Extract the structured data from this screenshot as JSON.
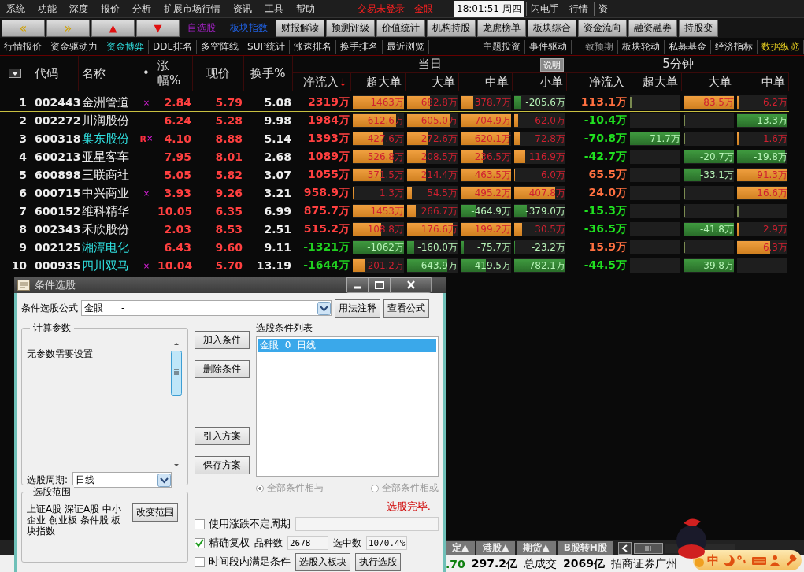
{
  "menu": {
    "items": [
      "系统",
      "功能",
      "深度",
      "报价",
      "分析",
      "扩展市场行情",
      "资讯",
      "工具",
      "帮助"
    ],
    "status": [
      "交易未登录",
      "金眼"
    ],
    "clock": "18:01:51 周四",
    "quick": [
      "闪电手",
      "行情",
      "资"
    ]
  },
  "toolbar": {
    "nav": [
      {
        "label": "«",
        "kind": "arrow"
      },
      {
        "label": "»",
        "kind": "arrow"
      },
      {
        "label": "▲",
        "kind": "triangle"
      },
      {
        "label": "▼",
        "kind": "triangle"
      }
    ],
    "links": [
      {
        "label": "自选股",
        "color": "#a020c0"
      },
      {
        "label": "板块指数",
        "color": "#2060e0"
      }
    ],
    "buttons": [
      "财报解读",
      "预测评级",
      "价值统计",
      "机构持股",
      "龙虎榜单",
      "板块综合",
      "资金流向",
      "融资融券",
      "持股变"
    ]
  },
  "tabs_left": [
    {
      "label": "行情报价",
      "selected": false
    },
    {
      "label": "资金驱动力",
      "selected": false
    },
    {
      "label": "资金博弈",
      "selected": true
    },
    {
      "label": "DDE排名",
      "selected": false
    },
    {
      "label": "多空阵线",
      "selected": false
    },
    {
      "label": "SUP统计",
      "selected": false
    },
    {
      "label": "涨速排名",
      "selected": false
    },
    {
      "label": "换手排名",
      "selected": false
    },
    {
      "label": "最近浏览",
      "selected": false
    }
  ],
  "tabs_right": [
    {
      "label": "主题投资",
      "kind": "normal"
    },
    {
      "label": "事件驱动",
      "kind": "normal"
    },
    {
      "label": "一致预期",
      "kind": "dim"
    },
    {
      "label": "板块轮动",
      "kind": "normal"
    },
    {
      "label": "私募基金",
      "kind": "normal"
    },
    {
      "label": "经济指标",
      "kind": "normal"
    },
    {
      "label": "数据纵览",
      "kind": "accent"
    }
  ],
  "table": {
    "columns": [
      "代码",
      "名称",
      "•",
      "涨幅%",
      "现价",
      "换手%"
    ],
    "group_today": {
      "title": "当日",
      "button": "说明",
      "columns": [
        "净流入",
        "超大单",
        "大单",
        "中单",
        "小单"
      ],
      "sort_arrow": "↓"
    },
    "group_5min": {
      "title": "5分钟",
      "columns": [
        "净流入",
        "超大单",
        "大单",
        "中单"
      ]
    },
    "rows": [
      {
        "rank": "1",
        "code": "002443",
        "name": "金洲管道",
        "highlight": false,
        "tag": "",
        "mark": "×",
        "change": "2.84",
        "price": "5.79",
        "turnover": "5.08",
        "selected": true,
        "net": {
          "value": "2319万",
          "kind": "up"
        },
        "bars": [
          {
            "value": "1463万",
            "kind": "up",
            "level": 1
          },
          {
            "value": "682.8万",
            "kind": "up",
            "level": 0.45
          },
          {
            "value": "378.7万",
            "kind": "up",
            "level": 0.25
          },
          {
            "value": "-205.6万",
            "kind": "down",
            "level": 0.12
          }
        ],
        "net5": {
          "value": "113.1万",
          "kind": "up"
        },
        "bars5": [
          {
            "kind": "flat"
          },
          {
            "value": "83.5万",
            "kind": "up",
            "level": 1
          },
          {
            "value": "6.2万",
            "kind": "up",
            "level": 0.05
          }
        ]
      },
      {
        "rank": "2",
        "code": "002272",
        "name": "川润股份",
        "highlight": false,
        "tag": "",
        "mark": "",
        "change": "6.24",
        "price": "5.28",
        "turnover": "9.98",
        "selected": false,
        "net": {
          "value": "1984万",
          "kind": "up"
        },
        "bars": [
          {
            "value": "612.6万",
            "kind": "up",
            "level": 0.85
          },
          {
            "value": "605.0万",
            "kind": "up",
            "level": 0.85
          },
          {
            "value": "704.9万",
            "kind": "up",
            "level": 1
          },
          {
            "value": "62.0万",
            "kind": "up",
            "level": 0.08
          }
        ],
        "net5": {
          "value": "-10.4万",
          "kind": "down"
        },
        "bars5": [
          {
            "kind": "empty"
          },
          {
            "kind": "flat"
          },
          {
            "value": "-13.3万",
            "kind": "down",
            "level": 1
          }
        ]
      },
      {
        "rank": "3",
        "code": "600318",
        "name": "巢东股份",
        "highlight": true,
        "tag": "R",
        "mark": "×",
        "change": "4.10",
        "price": "8.88",
        "turnover": "5.14",
        "selected": false,
        "net": {
          "value": "1393万",
          "kind": "up"
        },
        "bars": [
          {
            "value": "427.6万",
            "kind": "up",
            "level": 0.6
          },
          {
            "value": "272.6万",
            "kind": "up",
            "level": 0.4
          },
          {
            "value": "620.1万",
            "kind": "up",
            "level": 0.95
          },
          {
            "value": "72.8万",
            "kind": "up",
            "level": 0.1
          }
        ],
        "net5": {
          "value": "-70.8万",
          "kind": "down"
        },
        "bars5": [
          {
            "value": "-71.7万",
            "kind": "down",
            "level": 1
          },
          {
            "kind": "flat"
          },
          {
            "value": "1.6万",
            "kind": "up",
            "level": 0.03
          }
        ]
      },
      {
        "rank": "4",
        "code": "600213",
        "name": "亚星客车",
        "highlight": false,
        "tag": "",
        "mark": "",
        "change": "7.95",
        "price": "8.01",
        "turnover": "2.68",
        "selected": false,
        "net": {
          "value": "1089万",
          "kind": "up"
        },
        "bars": [
          {
            "value": "526.8万",
            "kind": "up",
            "level": 0.78
          },
          {
            "value": "208.5万",
            "kind": "up",
            "level": 0.38
          },
          {
            "value": "236.5万",
            "kind": "up",
            "level": 0.43
          },
          {
            "value": "116.9万",
            "kind": "up",
            "level": 0.22
          }
        ],
        "net5": {
          "value": "-42.7万",
          "kind": "down"
        },
        "bars5": [
          {
            "kind": "empty"
          },
          {
            "value": "-20.7万",
            "kind": "down",
            "level": 1
          },
          {
            "value": "-19.8万",
            "kind": "down",
            "level": 0.95
          }
        ]
      },
      {
        "rank": "5",
        "code": "600898",
        "name": "三联商社",
        "highlight": false,
        "tag": "",
        "mark": "",
        "change": "5.05",
        "price": "5.82",
        "turnover": "3.07",
        "selected": false,
        "net": {
          "value": "1055万",
          "kind": "up"
        },
        "bars": [
          {
            "value": "371.5万",
            "kind": "up",
            "level": 0.55
          },
          {
            "value": "214.4万",
            "kind": "up",
            "level": 0.38
          },
          {
            "value": "463.5万",
            "kind": "up",
            "level": 1
          },
          {
            "value": "6.0万",
            "kind": "up",
            "level": 0.02
          }
        ],
        "net5": {
          "value": "65.5万",
          "kind": "up"
        },
        "bars5": [
          {
            "kind": "empty"
          },
          {
            "value": "-33.1万",
            "kind": "down",
            "level": 0.35
          },
          {
            "value": "91.3万",
            "kind": "up",
            "level": 1
          }
        ]
      },
      {
        "rank": "6",
        "code": "000715",
        "name": "中兴商业",
        "highlight": false,
        "tag": "",
        "mark": "×",
        "change": "3.93",
        "price": "9.26",
        "turnover": "3.21",
        "selected": false,
        "net": {
          "value": "958.9万",
          "kind": "up"
        },
        "bars": [
          {
            "value": "1.3万",
            "kind": "up",
            "level": 0.02
          },
          {
            "value": "54.5万",
            "kind": "up",
            "level": 0.1
          },
          {
            "value": "495.2万",
            "kind": "up",
            "level": 1
          },
          {
            "value": "407.8万",
            "kind": "up",
            "level": 0.8
          }
        ],
        "net5": {
          "value": "24.0万",
          "kind": "up"
        },
        "bars5": [
          {
            "kind": "empty"
          },
          {
            "kind": "flat"
          },
          {
            "value": "16.6万",
            "kind": "up",
            "level": 1
          }
        ]
      },
      {
        "rank": "7",
        "code": "600152",
        "name": "维科精华",
        "highlight": false,
        "tag": "",
        "mark": "",
        "change": "10.05",
        "price": "6.35",
        "turnover": "6.99",
        "selected": false,
        "net": {
          "value": "875.7万",
          "kind": "up"
        },
        "bars": [
          {
            "value": "1453万",
            "kind": "up",
            "level": 1
          },
          {
            "value": "266.7万",
            "kind": "up",
            "level": 0.17
          },
          {
            "value": "-464.9万",
            "kind": "down",
            "level": 0.3
          },
          {
            "value": "-379.0万",
            "kind": "down",
            "level": 0.25
          }
        ],
        "net5": {
          "value": "-15.3万",
          "kind": "down"
        },
        "bars5": [
          {
            "kind": "empty"
          },
          {
            "kind": "flat"
          },
          {
            "kind": "flat"
          }
        ]
      },
      {
        "rank": "8",
        "code": "002343",
        "name": "禾欣股份",
        "highlight": false,
        "tag": "",
        "mark": "",
        "change": "2.03",
        "price": "8.53",
        "turnover": "2.51",
        "selected": false,
        "net": {
          "value": "515.2万",
          "kind": "up"
        },
        "bars": [
          {
            "value": "108.8万",
            "kind": "up",
            "level": 0.55
          },
          {
            "value": "176.6万",
            "kind": "up",
            "level": 0.9
          },
          {
            "value": "199.2万",
            "kind": "up",
            "level": 1
          },
          {
            "value": "30.5万",
            "kind": "up",
            "level": 0.15
          }
        ],
        "net5": {
          "value": "-36.5万",
          "kind": "down"
        },
        "bars5": [
          {
            "kind": "empty"
          },
          {
            "value": "-41.8万",
            "kind": "down",
            "level": 1
          },
          {
            "value": "2.9万",
            "kind": "up",
            "level": 0.05
          }
        ]
      },
      {
        "rank": "9",
        "code": "002125",
        "name": "湘潭电化",
        "highlight": true,
        "tag": "",
        "mark": "",
        "change": "6.43",
        "price": "9.60",
        "turnover": "9.11",
        "selected": false,
        "net": {
          "value": "-1321万",
          "kind": "down"
        },
        "bars": [
          {
            "value": "-1062万",
            "kind": "down",
            "level": 1
          },
          {
            "value": "-160.0万",
            "kind": "down",
            "level": 0.14
          },
          {
            "value": "-75.7万",
            "kind": "down",
            "level": 0.07
          },
          {
            "value": "-23.2万",
            "kind": "down",
            "level": 0.02
          }
        ],
        "net5": {
          "value": "15.9万",
          "kind": "up"
        },
        "bars5": [
          {
            "kind": "empty"
          },
          {
            "kind": "flat"
          },
          {
            "value": "6.3万",
            "kind": "up",
            "level": 0.65
          }
        ]
      },
      {
        "rank": "10",
        "code": "000935",
        "name": "四川双马",
        "highlight": true,
        "tag": "",
        "mark": "×",
        "change": "10.04",
        "price": "5.70",
        "turnover": "13.19",
        "selected": false,
        "net": {
          "value": "-1644万",
          "kind": "down"
        },
        "bars": [
          {
            "value": "201.2万",
            "kind": "up",
            "level": 0.25
          },
          {
            "value": "-643.9万",
            "kind": "down",
            "level": 0.8
          },
          {
            "value": "-419.5万",
            "kind": "down",
            "level": 0.5
          },
          {
            "value": "-782.1万",
            "kind": "down",
            "level": 1
          }
        ],
        "net5": {
          "value": "-44.5万",
          "kind": "down"
        },
        "bars5": [
          {
            "kind": "empty"
          },
          {
            "value": "-39.8万",
            "kind": "down",
            "level": 1
          },
          {
            "kind": "empty"
          }
        ]
      }
    ]
  },
  "bottom_tabs": [
    "定▲",
    "港股▲",
    "期货▲",
    "B股转H股"
  ],
  "status": [
    {
      "text": ".70",
      "kind": "green"
    },
    {
      "text": "297.2亿",
      "kind": "bold"
    },
    {
      "text": "总成交",
      "kind": "plain"
    },
    {
      "text": "2069亿",
      "kind": "bold"
    },
    {
      "text": "招商证券广州",
      "kind": "plain"
    }
  ],
  "ime": {
    "mode": "中"
  },
  "dialog": {
    "title": "条件选股",
    "formula_label": "条件选股公式",
    "formula_value": "金眼      -",
    "top_buttons": [
      "用法注释",
      "查看公式"
    ],
    "params_title": "计算参数",
    "params_text": "无参数需要设置",
    "period_label": "选股周期:",
    "period_value": "日线",
    "middle_buttons": [
      "加入条件",
      "删除条件",
      "引入方案",
      "保存方案"
    ],
    "list_label": "选股条件列表",
    "list_items": [
      {
        "text": "金眼  0  日线",
        "selected": true
      }
    ],
    "radios": [
      {
        "label": "全部条件相与",
        "selected": true
      },
      {
        "label": "全部条件相或",
        "selected": false
      }
    ],
    "result": "选股完毕.",
    "range_title": "选股范围",
    "range_text": "上证A股 深证A股 中小企业 创业板 条件股 板块指数",
    "range_button": "改变范围",
    "checks": [
      {
        "label": "使用涨跌不定周期",
        "checked": false
      },
      {
        "label": "精确复权",
        "checked": true
      },
      {
        "label": "时间段内满足条件",
        "checked": false
      }
    ],
    "count_label": "品种数",
    "count_value": "2678",
    "picked_label": "选中数",
    "picked_value": "10/0.4%",
    "bottom_buttons": [
      "选股入板块",
      "执行选股"
    ]
  }
}
